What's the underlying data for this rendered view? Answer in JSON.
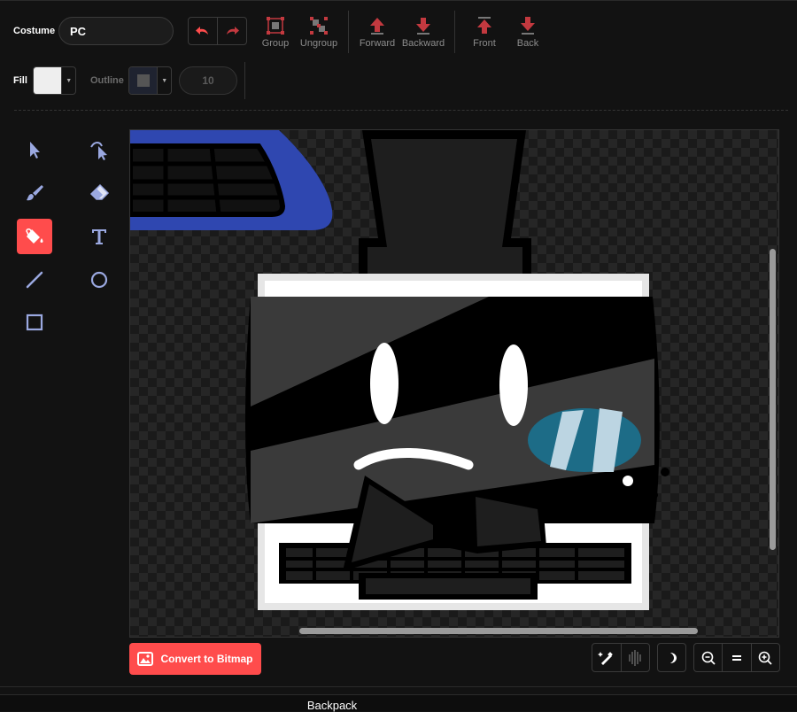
{
  "toolbar": {
    "costume_label": "Costume",
    "costume_name": "PC",
    "buttons": [
      {
        "label": "Group"
      },
      {
        "label": "Ungroup"
      },
      {
        "label": "Forward"
      },
      {
        "label": "Backward"
      },
      {
        "label": "Front"
      },
      {
        "label": "Back"
      }
    ],
    "fill_label": "Fill",
    "fill_color": "#eeeeee",
    "outline_label": "Outline",
    "outline_color": "#555555",
    "outline_width": "10"
  },
  "tools": [
    {
      "name": "select",
      "icon": "arrow-cursor-icon"
    },
    {
      "name": "reshape",
      "icon": "reshape-cursor-icon"
    },
    {
      "name": "brush",
      "icon": "brush-icon"
    },
    {
      "name": "eraser",
      "icon": "eraser-icon"
    },
    {
      "name": "fill",
      "icon": "paint-bucket-icon",
      "active": true
    },
    {
      "name": "text",
      "icon": "text-icon"
    },
    {
      "name": "line",
      "icon": "line-icon"
    },
    {
      "name": "circle",
      "icon": "circle-icon"
    },
    {
      "name": "rectangle",
      "icon": "rectangle-icon"
    }
  ],
  "convert_button": "Convert to Bitmap",
  "backpack": "Backpack",
  "colors": {
    "accent": "#ff4c4c",
    "icon_tint": "#9aa8e0",
    "arrow_red": "#c3393f"
  }
}
